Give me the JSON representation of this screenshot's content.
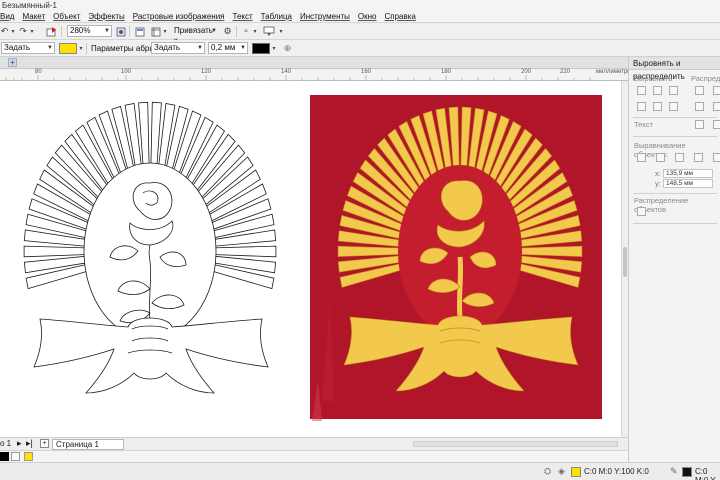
{
  "window": {
    "title": "Безымянный-1"
  },
  "menu": [
    "Вид",
    "Макет",
    "Объект",
    "Эффекты",
    "Растровые изображения",
    "Текст",
    "Таблица",
    "Инструменты",
    "Окно",
    "Справка"
  ],
  "toolbar": {
    "zoom": "280%",
    "snap_label": "Привязать к"
  },
  "propbar": {
    "fill_select": "Задать",
    "outline_params_label": "Параметры абриса:",
    "outline_select": "Задать",
    "width": "0,2 мм",
    "accent_color": "#ffe000"
  },
  "ruler": {
    "unit": "миллиметры",
    "labels": [
      "80",
      "100",
      "120",
      "140",
      "160",
      "180",
      "200",
      "220"
    ]
  },
  "page_nav": {
    "page_counter": "о 1",
    "page_tab": "Страница 1"
  },
  "docker": {
    "title": "Выровнять и распределить",
    "align_label": "Выровнять",
    "distribute_label": "Распреде",
    "text_label": "Текст",
    "spacing_label": "Выравнивание объектов:",
    "x_value": "135,9 мм",
    "y_value": "148,5 мм",
    "object_distribution_label": "Распределение объектов"
  },
  "status": {
    "fill_color_text": "C:0 M:0 Y:100 K:0",
    "outline_color_text": "C:0 M:0 Y",
    "fill_swatch": "#ffe000",
    "outline_swatch": "#111111"
  },
  "artwork": {
    "background": "#b0152a",
    "gold": "#f2c94c",
    "outline_stroke": "#1a1a1a"
  }
}
